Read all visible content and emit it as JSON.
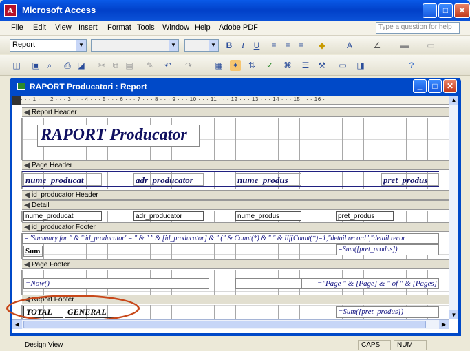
{
  "app": {
    "title": "Microsoft Access",
    "icon_letter": "A"
  },
  "menu": {
    "items": [
      "File",
      "Edit",
      "View",
      "Insert",
      "Format",
      "Tools",
      "Window",
      "Help",
      "Adobe PDF"
    ],
    "help_placeholder": "Type a question for help"
  },
  "formatting_toolbar": {
    "object_combo": "Report",
    "bold": "B",
    "italic": "I",
    "underline": "U"
  },
  "child_window": {
    "title": "RAPORT Producatori : Report"
  },
  "ruler": {
    "text": "· · · 1 · · · 2 · · · 3 · · · 4 · · · 5 · · · 6 · · · 7 · · · 8 · · · 9 · · · 10 · · · 11 · · · 12 · · · 13 · · · 14 · · · 15 · · · 16 · · ·"
  },
  "sections": {
    "report_header": "Report Header",
    "page_header": "Page Header",
    "group_header": "id_producator Header",
    "detail": "Detail",
    "group_footer": "id_producator Footer",
    "page_footer": "Page Footer",
    "report_footer": "Report Footer"
  },
  "report_header": {
    "title_label": "RAPORT Producator"
  },
  "page_header": {
    "labels": [
      "nume_producat",
      "adr_producator",
      "nume_produs",
      "pret_produs"
    ]
  },
  "detail": {
    "fields": [
      "nume_producat",
      "adr_producator",
      "nume_produs",
      "pret_produs"
    ]
  },
  "group_footer": {
    "summary_expr": "=\"Summary for \" & \"'id_producator' = \" & \" \" & [id_producator] & \" (\" & Count(*) & \" \" & IIf(Count(*)=1,\"detail record\",\"detail recor",
    "sum_label": "Sum",
    "sum_expr": "=Sum([pret_produs])"
  },
  "page_footer": {
    "now_expr": "=Now()",
    "page_expr": "=\"Page \" & [Page] & \" of \" & [Pages]"
  },
  "report_footer": {
    "total_label_1": "TOTAL",
    "total_label_2": "GENERAL",
    "sum_expr": "=Sum([pret_produs])"
  },
  "status": {
    "mode": "Design View",
    "caps": "CAPS",
    "num": "NUM"
  },
  "colors": {
    "titlebar": "#0A5AE8",
    "highlight_ellipse": "#C8481A",
    "label_text": "#101060"
  }
}
